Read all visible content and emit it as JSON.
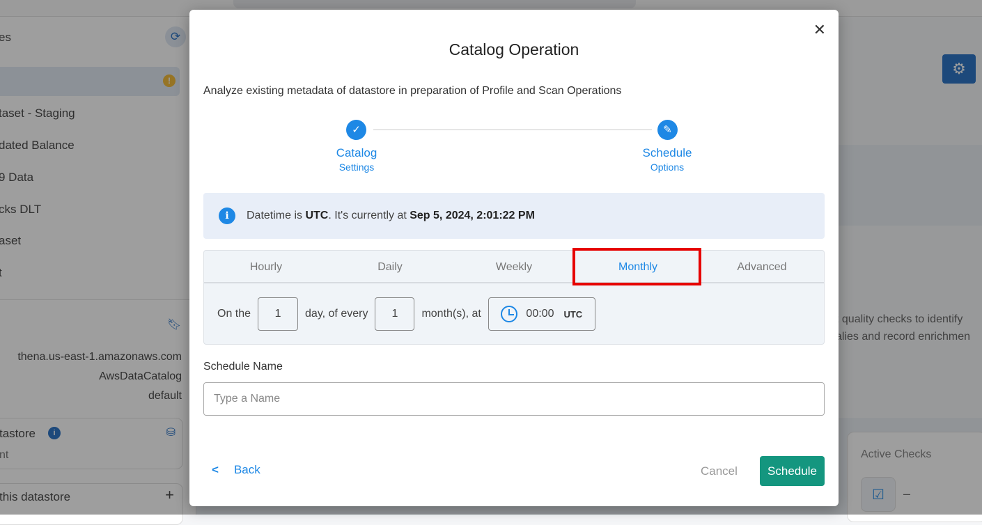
{
  "background": {
    "sidebar": {
      "title": "es",
      "items": [
        "",
        "taset - Staging",
        "dated Balance",
        "9 Data",
        "cks DLT",
        "aset",
        "t"
      ],
      "details": {
        "host": "thena.us-east-1.amazonaws.com",
        "catalog": "AwsDataCatalog",
        "database": "default"
      },
      "card1": {
        "title": "tastore",
        "sub": "nt"
      },
      "card2": {
        "title": "this datastore"
      }
    },
    "right": {
      "text_line1": "t quality checks to identify",
      "text_line2": "alies and record enrichmen",
      "active_checks_label": "Active Checks",
      "active_checks_value": "–"
    }
  },
  "modal": {
    "title": "Catalog Operation",
    "description": "Analyze existing metadata of datastore in preparation of Profile and Scan Operations",
    "steps": [
      {
        "label": "Catalog",
        "sublabel": "Settings",
        "icon": "check-icon"
      },
      {
        "label": "Schedule",
        "sublabel": "Options",
        "icon": "pencil-icon"
      }
    ],
    "info": {
      "prefix": "Datetime is ",
      "tz": "UTC",
      "middle": ". It's currently at ",
      "datetime": "Sep 5, 2024, 2:01:22 PM"
    },
    "tabs": [
      "Hourly",
      "Daily",
      "Weekly",
      "Monthly",
      "Advanced"
    ],
    "active_tab": "Monthly",
    "monthly": {
      "on_the": "On the",
      "day_value": "1",
      "day_of_every": "day, of every",
      "month_value": "1",
      "months_at": "month(s), at",
      "time": "00:00",
      "tz": "UTC"
    },
    "schedule_name_label": "Schedule Name",
    "schedule_name_placeholder": "Type a Name",
    "schedule_name_value": "",
    "back_label": "Back",
    "cancel_label": "Cancel",
    "schedule_label": "Schedule"
  },
  "colors": {
    "accent": "#1e88e5",
    "primary_button": "#14967f",
    "highlight": "#e60000"
  }
}
